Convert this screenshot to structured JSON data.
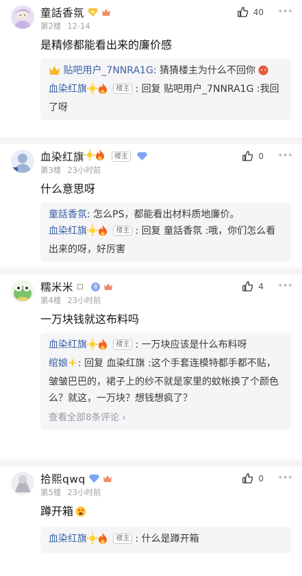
{
  "posts": [
    {
      "username": "童話香氛",
      "floor": "第2楼",
      "time": "12-14",
      "likes": "40",
      "content": "是精修都能看出来的廉价感",
      "replies": [
        {
          "name": "贴吧用户_7NNRA1G",
          "is_op": false,
          "text": ": 猜猜楼主为什么不回你"
        },
        {
          "name": "血染红旗",
          "is_op": true,
          "op_label": "楼主",
          "text": ": 回复 贴吧用户_7NNRA1G :我回了呀"
        }
      ]
    },
    {
      "username": "血染红旗",
      "op_label": "楼主",
      "floor": "第3楼",
      "time": "23小时前",
      "likes": "0",
      "content": "什么意思呀",
      "replies": [
        {
          "name": "童話香氛",
          "is_op": false,
          "text": ": 怎么PS，都能看出材料质地廉价。"
        },
        {
          "name": "血染红旗",
          "is_op": true,
          "op_label": "楼主",
          "text": ": 回复 童話香氛 :哦，你们怎么看出来的呀，好厉害"
        }
      ]
    },
    {
      "username": "糯米米",
      "floor": "第4楼",
      "time": "23小时前",
      "likes": "4",
      "level": "8",
      "content": "一万块钱就这布料吗",
      "replies": [
        {
          "name": "血染红旗",
          "is_op": true,
          "op_label": "楼主",
          "text": ": 一万块应该是什么布料呀"
        },
        {
          "name": "绾娘",
          "is_op": false,
          "text": ": 回复 血染红旗 :这个手套连模特都手都不贴，皱皱巴巴的，裙子上的纱不就是家里的蚊帐换了个颜色么？就这，一万块？想钱想疯了？"
        }
      ],
      "more_comments": "查看全部8条评论"
    },
    {
      "username": "拾熙qwq",
      "floor": "第5楼",
      "time": "23小时前",
      "likes": "0",
      "content": "蹲开箱",
      "replies": [
        {
          "name": "血染红旗",
          "is_op": true,
          "op_label": "楼主",
          "text": ": 什么是蹲开箱"
        }
      ]
    }
  ],
  "icons": {
    "like": "like-hand-icon",
    "more": "more-dots-icon"
  },
  "colors": {
    "link_blue": "#3d62a4",
    "meta_gray": "#a0a0a6",
    "reply_bg": "#f5f5f7"
  }
}
